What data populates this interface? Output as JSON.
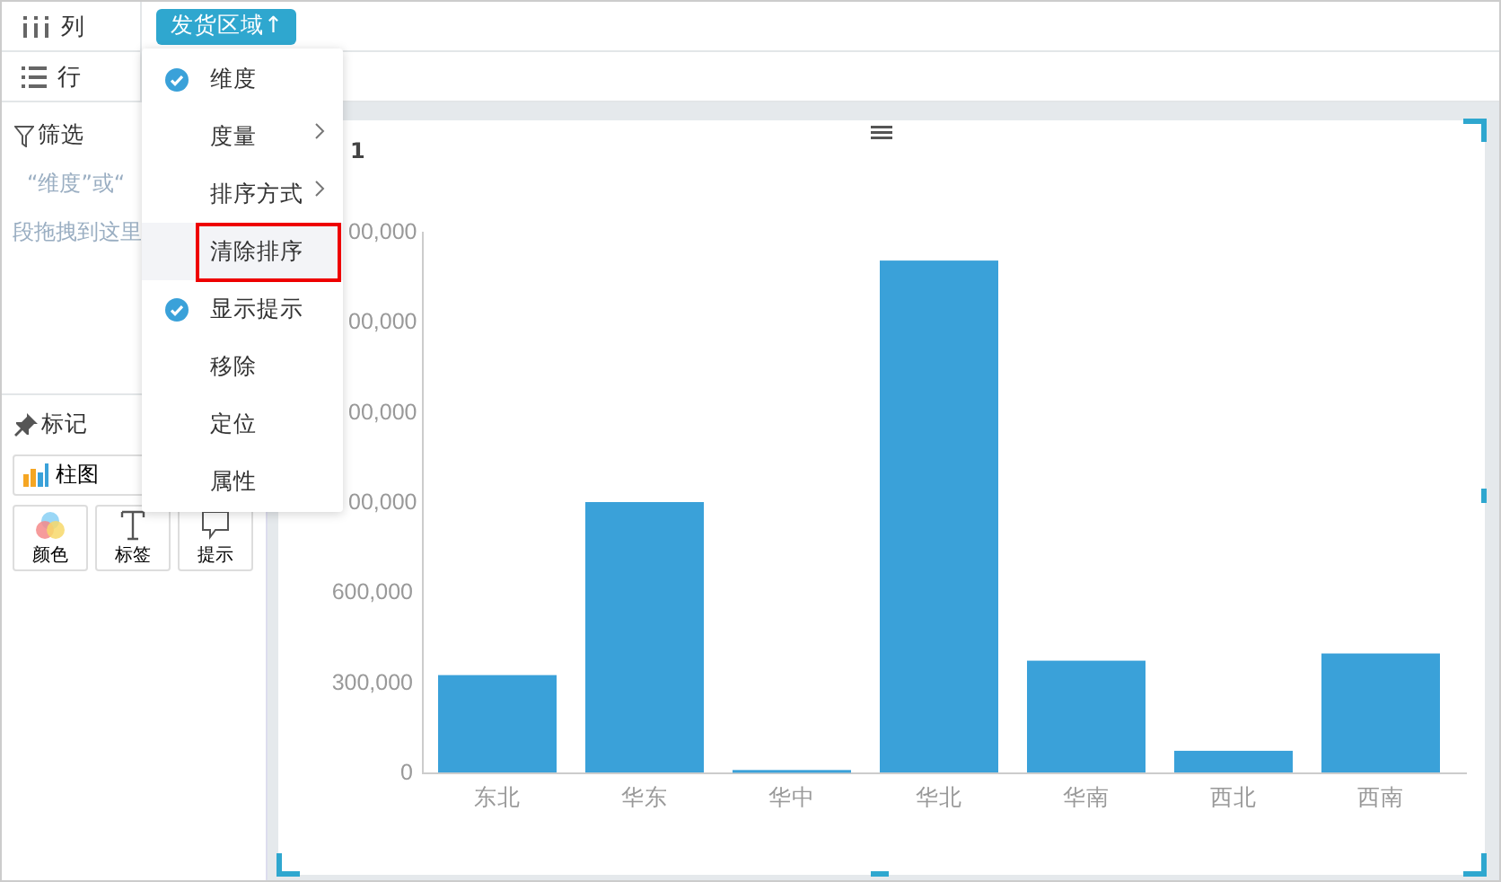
{
  "shelves": {
    "columns_label": "列",
    "rows_label": "行",
    "field_pill": "发货区域↑"
  },
  "filter": {
    "title": "筛选",
    "hint_lines": [
      "“维度”或“",
      "段拖拽到这里"
    ]
  },
  "marks": {
    "title": "标记",
    "chart_type": "柱图",
    "buttons": [
      {
        "label": "颜色",
        "kind": "color"
      },
      {
        "label": "标签",
        "kind": "label"
      },
      {
        "label": "提示",
        "kind": "tooltip"
      }
    ]
  },
  "context_menu": [
    {
      "label": "维度",
      "checked": true,
      "submenu": false,
      "selected": false
    },
    {
      "label": "度量",
      "checked": false,
      "submenu": true,
      "selected": false
    },
    {
      "label": "排序方式",
      "checked": false,
      "submenu": true,
      "selected": false
    },
    {
      "label": "清除排序",
      "checked": false,
      "submenu": false,
      "selected": true
    },
    {
      "label": "显示提示",
      "checked": true,
      "submenu": false,
      "selected": false
    },
    {
      "label": "移除",
      "checked": false,
      "submenu": false,
      "selected": false
    },
    {
      "label": "定位",
      "checked": false,
      "submenu": false,
      "selected": false
    },
    {
      "label": "属性",
      "checked": false,
      "submenu": false,
      "selected": false
    }
  ],
  "chart": {
    "title": "1",
    "chart_data": {
      "type": "bar",
      "categories": [
        "东北",
        "华东",
        "华中",
        "华北",
        "华南",
        "西北",
        "西南"
      ],
      "values": [
        324000,
        900000,
        8000,
        1704000,
        372000,
        72000,
        396000
      ],
      "ylim": [
        0,
        1800000
      ],
      "yticks": [
        {
          "value": 0,
          "label": "0"
        },
        {
          "value": 300000,
          "label": "300,000"
        },
        {
          "value": 600000,
          "label": "600,000"
        }
      ]
    },
    "covered_tick_labels": [
      "00,000",
      "00,000",
      "00,000",
      "00,000"
    ]
  }
}
